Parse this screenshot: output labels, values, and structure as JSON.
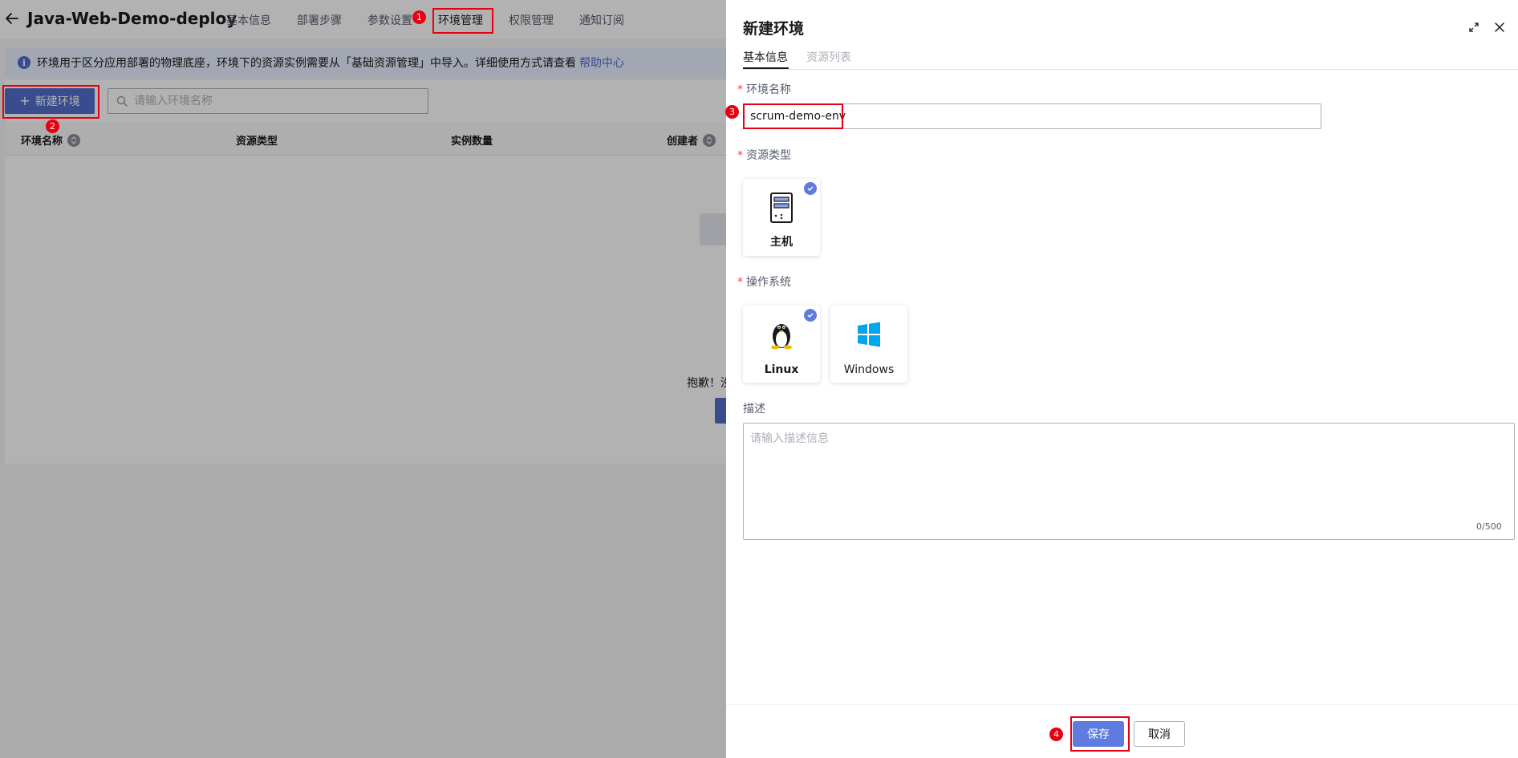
{
  "app": {
    "title": "Java-Web-Demo-deploy",
    "tabs": [
      "基本信息",
      "部署步骤",
      "参数设置",
      "环境管理",
      "权限管理",
      "通知订阅"
    ],
    "active_tab": "环境管理"
  },
  "info": {
    "text": "环境用于区分应用部署的物理底座，环境下的资源实例需要从「基础资源管理」中导入。详细使用方式请查看",
    "link": "帮助中心"
  },
  "toolbar": {
    "new_env_label": "新建环境",
    "search_placeholder": "请输入环境名称"
  },
  "table": {
    "columns": [
      "环境名称",
      "资源类型",
      "实例数量",
      "创建者"
    ]
  },
  "empty": {
    "text": "抱歉！没"
  },
  "drawer": {
    "title": "新建环境",
    "tabs": [
      "基本信息",
      "资源列表"
    ],
    "fields": {
      "env_name_label": "环境名称",
      "env_name_value": "scrum-demo-env",
      "resource_type_label": "资源类型",
      "os_label": "操作系统",
      "desc_label": "描述",
      "desc_placeholder": "请输入描述信息",
      "desc_count": "0/500"
    },
    "resource_types": [
      {
        "label": "主机",
        "selected": true
      }
    ],
    "os_options": [
      {
        "label": "Linux",
        "selected": true
      },
      {
        "label": "Windows",
        "selected": false
      }
    ],
    "save_label": "保存",
    "cancel_label": "取消"
  },
  "annotations": [
    "1",
    "2",
    "3",
    "4"
  ],
  "colors": {
    "primary": "#526ecc",
    "highlight": "#e60012",
    "check": "#5e7ce0"
  }
}
